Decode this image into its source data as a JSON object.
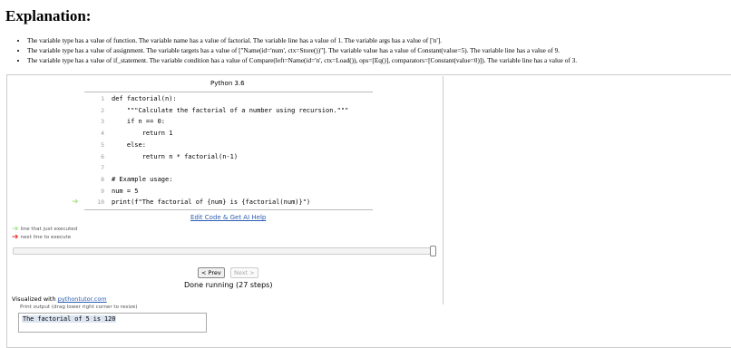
{
  "heading": "Explanation:",
  "explanations": [
    "The variable type has a value of function. The variable name has a value of factorial. The variable line has a value of 1. The variable args has a value of ['n'].",
    "The variable type has a value of assignment. The variable targets has a value of [\"Name(id='num', ctx=Store())\"]. The variable value has a value of Constant(value=5). The variable line has a value of 9.",
    "The variable type has a value of if_statement. The variable condition has a value of Compare(left=Name(id='n', ctx=Load()), ops=[Eq()], comparators=[Constant(value=0)]). The variable line has a value of 3."
  ],
  "visualizer": {
    "language": "Python 3.6",
    "code_lines": [
      {
        "num": "1",
        "text": "def factorial(n):"
      },
      {
        "num": "2",
        "text": "    \"\"\"Calculate the factorial of a number using recursion.\"\"\""
      },
      {
        "num": "3",
        "text": "    if n == 0:"
      },
      {
        "num": "4",
        "text": "        return 1"
      },
      {
        "num": "5",
        "text": "    else:"
      },
      {
        "num": "6",
        "text": "        return n * factorial(n-1)"
      },
      {
        "num": "7",
        "text": ""
      },
      {
        "num": "8",
        "text": "# Example usage:"
      },
      {
        "num": "9",
        "text": "num = 5"
      },
      {
        "num": "10",
        "text": "print(f\"The factorial of {num} is {factorial(num)}\")"
      }
    ],
    "current_line": "10",
    "edit_link": "Edit Code & Get AI Help",
    "legend_executed": "line that just executed",
    "legend_next": "next line to execute",
    "legend_colors": {
      "executed": "#a8e58c",
      "next": "#e33"
    },
    "progress": 1.0,
    "prev_label": "< Prev",
    "next_label": "Next >",
    "status": "Done running (27 steps)",
    "visualized_with": "Visualized with",
    "pythontutor": "pythontutor.com",
    "print_output_label": "Print output (drag lower right corner to resize)",
    "print_output": "The factorial of 5 is 120"
  }
}
